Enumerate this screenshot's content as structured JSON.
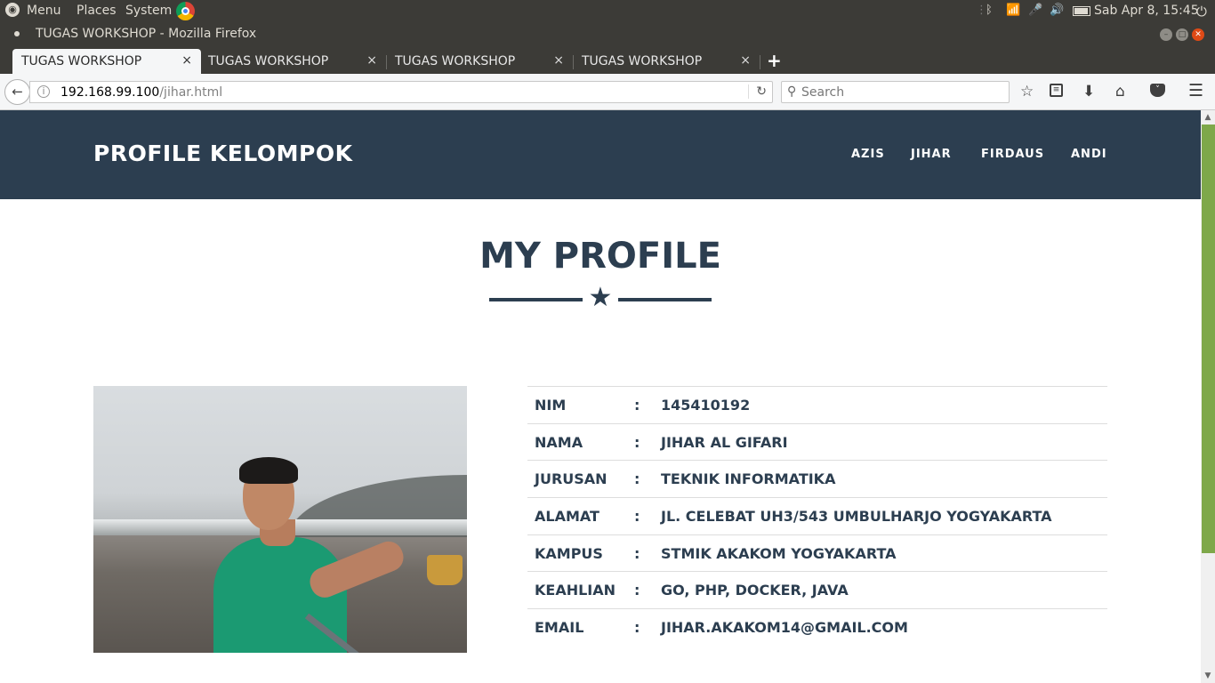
{
  "system_bar": {
    "menu": "Menu",
    "places": "Places",
    "system": "System",
    "datetime": "Sab Apr  8, 15:45"
  },
  "window": {
    "title": "TUGAS WORKSHOP - Mozilla Firefox"
  },
  "tabs": [
    {
      "label": "TUGAS WORKSHOP",
      "close": "×"
    },
    {
      "label": "TUGAS WORKSHOP",
      "close": "×"
    },
    {
      "label": "TUGAS WORKSHOP",
      "close": "×"
    },
    {
      "label": "TUGAS WORKSHOP",
      "close": "×"
    }
  ],
  "new_tab": "+",
  "address": {
    "host": "192.168.99.100",
    "path": "/jihar.html"
  },
  "search": {
    "placeholder": "Search"
  },
  "site": {
    "brand": "PROFILE KELOMPOK",
    "nav": [
      "AZIS",
      "JIHAR",
      "FIRDAUS",
      "ANDI"
    ],
    "heading": "MY PROFILE"
  },
  "profile": {
    "separator": ":",
    "rows": [
      {
        "label": "NIM",
        "value": "145410192"
      },
      {
        "label": "NAMA",
        "value": "JIHAR AL GIFARI"
      },
      {
        "label": "JURUSAN",
        "value": "TEKNIK INFORMATIKA"
      },
      {
        "label": "ALAMAT",
        "value": "JL. CELEBAT UH3/543 UMBULHARJO YOGYAKARTA"
      },
      {
        "label": "KAMPUS",
        "value": "STMIK AKAKOM YOGYAKARTA"
      },
      {
        "label": "KEAHLIAN",
        "value": "GO, PHP, DOCKER, JAVA"
      },
      {
        "label": "EMAIL",
        "value": "JIHAR.AKAKOM14@GMAIL.COM"
      }
    ]
  },
  "colors": {
    "header_bg": "#2c3e50",
    "heading": "#2c3e50",
    "scrollbar_thumb": "#7ea84a",
    "os_chrome": "#3c3b37"
  },
  "icons": {
    "divider": "star-icon",
    "toolbar": [
      "bookmark-star-icon",
      "reading-list-icon",
      "download-icon",
      "home-icon",
      "pocket-icon",
      "hamburger-menu-icon"
    ]
  }
}
